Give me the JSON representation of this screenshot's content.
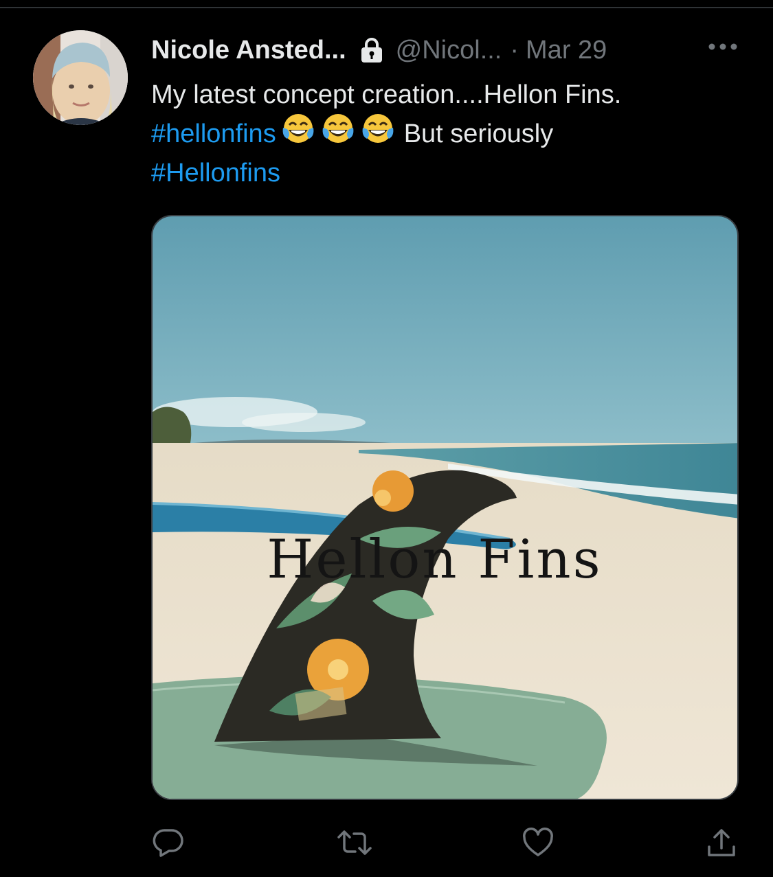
{
  "tweet": {
    "author_name": "Nicole Ansted...",
    "handle": "@Nicol...",
    "separator": "·",
    "date": "Mar 29",
    "text_line1": "My latest concept creation....Hellon Fins.",
    "hashtag1": "#hellonfins",
    "after_emoji": "But seriously",
    "hashtag2": "#Hellonfins",
    "emoji_names": [
      "laughing-tears-emoji",
      "laughing-tears-emoji",
      "laughing-tears-emoji"
    ],
    "protected": true
  },
  "media": {
    "overlay_title": "Hellon Fins",
    "description_icons": [
      "surfboard",
      "floral-fin",
      "beach",
      "ocean"
    ]
  },
  "actions": {
    "icons": [
      "reply-icon",
      "retweet-icon",
      "like-icon",
      "share-icon"
    ]
  },
  "colors": {
    "background": "#000000",
    "primary_text": "#e7e9ea",
    "secondary_text": "#71767b",
    "link": "#1d9bf0"
  }
}
